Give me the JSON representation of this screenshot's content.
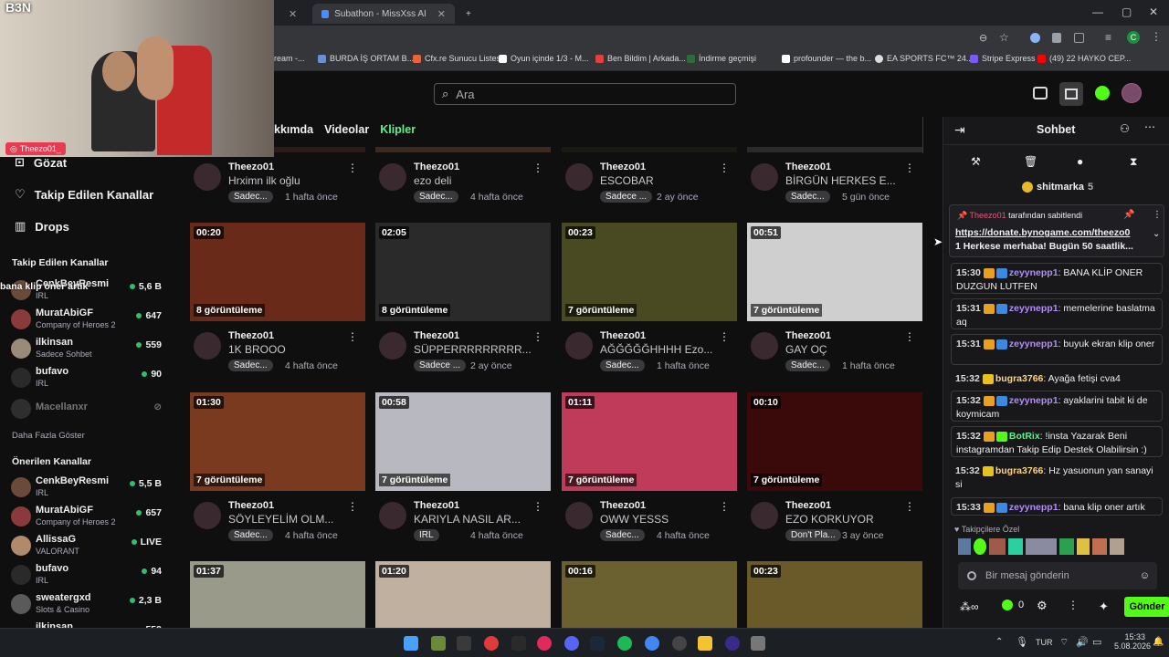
{
  "browser": {
    "tabs": [
      {
        "label": "Subathon - MissXss AI Bot Syst"
      }
    ],
    "bookmarks": [
      "ream -...",
      "BURDA İŞ ORTAM B...",
      "Cfx.re Sunucu Listesi",
      "Oyun içinde 1/3 - M...",
      "Ben Bildim | Arkada...",
      "İndirme geçmişi",
      "profounder — the b...",
      "EA SPORTS FC™ 24...",
      "Stripe Express",
      "(49) 22 HAYKO CEP..."
    ],
    "colors": {
      "chrome_bg": "#202124",
      "toolbar": "#35363a"
    }
  },
  "site": {
    "search_placeholder": "Ara",
    "channel_tabs": [
      "kkımda",
      "Videolar",
      "Klipler"
    ],
    "active_tab_color": "#5cf08b"
  },
  "sidebar": {
    "nav": [
      "Gözat",
      "Takip Edilen Kanallar",
      "Drops"
    ],
    "followed_title": "Takip Edilen Kanallar",
    "followed": [
      {
        "name": "CenkBeyResmi",
        "category": "IRL",
        "viewers": "5,6 B"
      },
      {
        "name": "MuratAbiGF",
        "category": "Company of Heroes 2",
        "viewers": "647"
      },
      {
        "name": "ilkinsan",
        "category": "Sadece Sohbet",
        "viewers": "559"
      },
      {
        "name": "bufavo",
        "category": "IRL",
        "viewers": "90"
      },
      {
        "name": "Macellanxr",
        "category": "",
        "viewers": ""
      }
    ],
    "show_more": "Daha Fazla Göster",
    "recommended_title": "Önerilen Kanallar",
    "recommended": [
      {
        "name": "CenkBeyResmi",
        "category": "IRL",
        "viewers": "5,5 B"
      },
      {
        "name": "MuratAbiGF",
        "category": "Company of Heroes 2",
        "viewers": "657"
      },
      {
        "name": "AllissaG",
        "category": "VALORANT",
        "viewers": "LIVE"
      },
      {
        "name": "bufavo",
        "category": "IRL",
        "viewers": "94"
      },
      {
        "name": "sweatergxd",
        "category": "Slots & Casino",
        "viewers": "2,3 B"
      },
      {
        "name": "ilkinsan",
        "category": "",
        "viewers": "559"
      }
    ],
    "overlay_chat": "bana klip oner artık"
  },
  "clips": [
    {
      "author": "Theezo01",
      "title": "Hrximn ilk oğlu",
      "tag": "Sadec...",
      "age": "1 hafta önce"
    },
    {
      "author": "Theezo01",
      "title": "ezo deli",
      "tag": "Sadec...",
      "age": "4 hafta önce"
    },
    {
      "author": "Theezo01",
      "title": "ESCOBAR",
      "tag": "Sadece ...",
      "age": "2 ay önce"
    },
    {
      "author": "Theezo01",
      "title": "BİRGÜN HERKES E...",
      "tag": "Sadec...",
      "age": "5 gün önce"
    },
    {
      "duration": "00:20",
      "views": "8 görüntüleme",
      "author": "Theezo01",
      "title": "1K BROOO",
      "tag": "Sadec...",
      "age": "4 hafta önce"
    },
    {
      "duration": "02:05",
      "views": "8 görüntüleme",
      "author": "Theezo01",
      "title": "SÜPPERRRRRRRRR...",
      "tag": "Sadece ...",
      "age": "2 ay önce"
    },
    {
      "duration": "00:23",
      "views": "7 görüntüleme",
      "author": "Theezo01",
      "title": "AĞĞĞĞĞHHHH Ezo...",
      "tag": "Sadec...",
      "age": "1 hafta önce"
    },
    {
      "duration": "00:51",
      "views": "7 görüntüleme",
      "author": "Theezo01",
      "title": "GAY OÇ",
      "tag": "Sadec...",
      "age": "1 hafta önce"
    },
    {
      "duration": "01:30",
      "views": "7 görüntüleme",
      "author": "Theezo01",
      "title": "SÖYLEYELİM OLM...",
      "tag": "Sadec...",
      "age": "4 hafta önce"
    },
    {
      "duration": "00:58",
      "views": "7 görüntüleme",
      "author": "Theezo01",
      "title": "KARIYLA NASIL AR...",
      "tag": "IRL",
      "age": "4 hafta önce"
    },
    {
      "duration": "01:11",
      "views": "7 görüntüleme",
      "author": "Theezo01",
      "title": "OWW YESSS",
      "tag": "Sadec...",
      "age": "4 hafta önce"
    },
    {
      "duration": "00:10",
      "views": "7 görüntüleme",
      "author": "Theezo01",
      "title": "EZO KORKUYOR",
      "tag": "Don't Pla...",
      "age": "3 ay önce"
    },
    {
      "duration": "01:37"
    },
    {
      "duration": "01:20"
    },
    {
      "duration": "00:16"
    },
    {
      "duration": "00:23"
    }
  ],
  "chat": {
    "title": "Sohbet",
    "top_user": "shitmarka",
    "top_count": "5",
    "pinned_by_user": "Theezo01",
    "pinned_by_text": "tarafından sabitlendi",
    "pinned_link": "https://donate.bynogame.com/theezo0",
    "pinned_rest": "1 Herkese merhaba! Bugün 50 saatlik...",
    "messages": [
      {
        "time": "15:30",
        "user": "zeyynepp1",
        "text": ": BANA KLİP ONER DUZGUN LUTFEN",
        "color": "pink"
      },
      {
        "time": "15:31",
        "user": "zeyynepp1",
        "text": ": memelerine baslatma aq",
        "color": "pink"
      },
      {
        "time": "15:31",
        "user": "zeyynepp1",
        "text": ": buyuk ekran klip oner",
        "color": "pink"
      },
      {
        "time": "15:32",
        "user": "bugra3766",
        "text": ": Ayağa fetişi cva4",
        "color": "yel"
      },
      {
        "time": "15:32",
        "user": "zeyynepp1",
        "text": ": ayaklarini tabit ki de koymicam",
        "color": "pink"
      },
      {
        "time": "15:32",
        "user": "BotRix",
        "text": ": !insta Yazarak Beni instagramdan Takip Edip Destek Olabilirsin :)",
        "color": "grn"
      },
      {
        "time": "15:32",
        "user": "bugra3766",
        "text": ": Hz yasuonun yan sanayi si",
        "color": "yel"
      },
      {
        "time": "15:33",
        "user": "zeyynepp1",
        "text": ": bana klip oner artık",
        "color": "pink"
      }
    ],
    "followers_only": "Takipçilere Özel",
    "input_placeholder": "Bir mesaj gönderin",
    "points": "0",
    "send_label": "Gönder"
  },
  "webcam": {
    "label": "Theezo01_",
    "logo": "B3N"
  },
  "taskbar": {
    "lang": "TUR",
    "time": "15:33",
    "date": "5.08.2026"
  }
}
